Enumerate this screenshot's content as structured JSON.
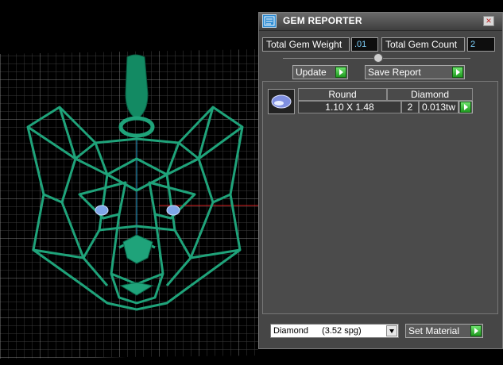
{
  "panel": {
    "title": "GEM REPORTER",
    "close_glyph": "×",
    "weight_label": "Total Gem Weight",
    "weight_value": ".01",
    "count_label": "Total Gem Count",
    "count_value": "2",
    "update_label": "Update",
    "save_label": "Save Report",
    "table": {
      "shape": "Round",
      "material": "Diamond",
      "size": "1.10 X 1.48",
      "count": "2",
      "weight": "0.013tw"
    },
    "material_select": {
      "name": "Diamond",
      "spg": "(3.52 spg)"
    },
    "set_material_label": "Set Material"
  },
  "colors": {
    "model": "#1fa37a",
    "grid": "#6a6a6a",
    "gem_blue": "#7fa6e8",
    "go_green": "#2bb52b"
  },
  "icons": [
    "app-icon",
    "close-icon",
    "go-arrow-icon",
    "gem-thumbnail-icon",
    "dropdown-arrow-icon"
  ]
}
